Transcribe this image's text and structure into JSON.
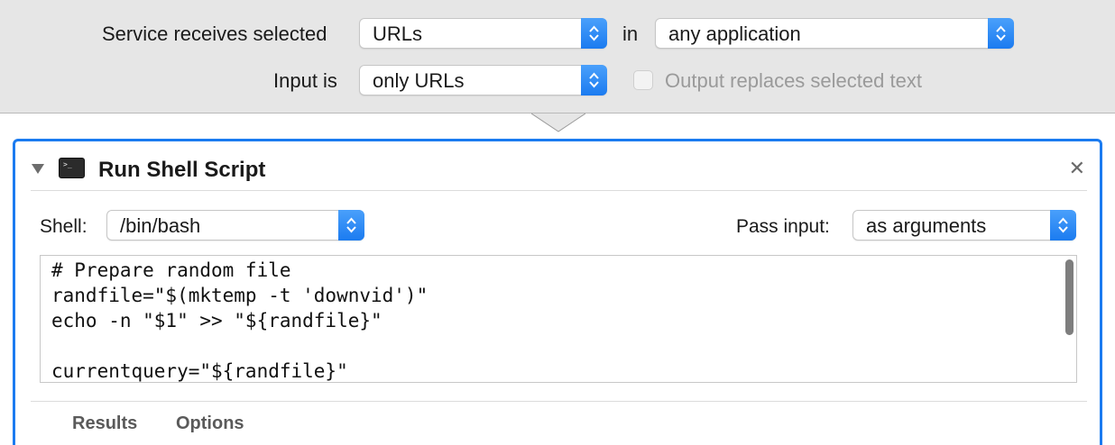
{
  "service_bar": {
    "receives_label": "Service receives selected",
    "receives_value": "URLs",
    "in_label": "in",
    "app_value": "any application",
    "input_label": "Input is",
    "input_value": "only URLs",
    "output_replaces_label": "Output replaces selected text",
    "output_replaces_checked": false
  },
  "action": {
    "title": "Run Shell Script",
    "shell_label": "Shell:",
    "shell_value": "/bin/bash",
    "pass_input_label": "Pass input:",
    "pass_input_value": "as arguments",
    "script_lines": [
      "# Prepare random file",
      "randfile=\"$(mktemp -t 'downvid')\"",
      "echo -n \"$1\" >> \"${randfile}\"",
      "",
      "currentquery=\"${randfile}\""
    ],
    "tabs": [
      "Results",
      "Options"
    ]
  },
  "colors": {
    "accent": "#1b7bf0",
    "bar_background": "#e6e6e6"
  },
  "icons": {
    "stepper": "updown-chevron-icon",
    "disclosure": "disclosure-triangle-icon",
    "terminal": "terminal-icon",
    "close": "close-icon"
  }
}
